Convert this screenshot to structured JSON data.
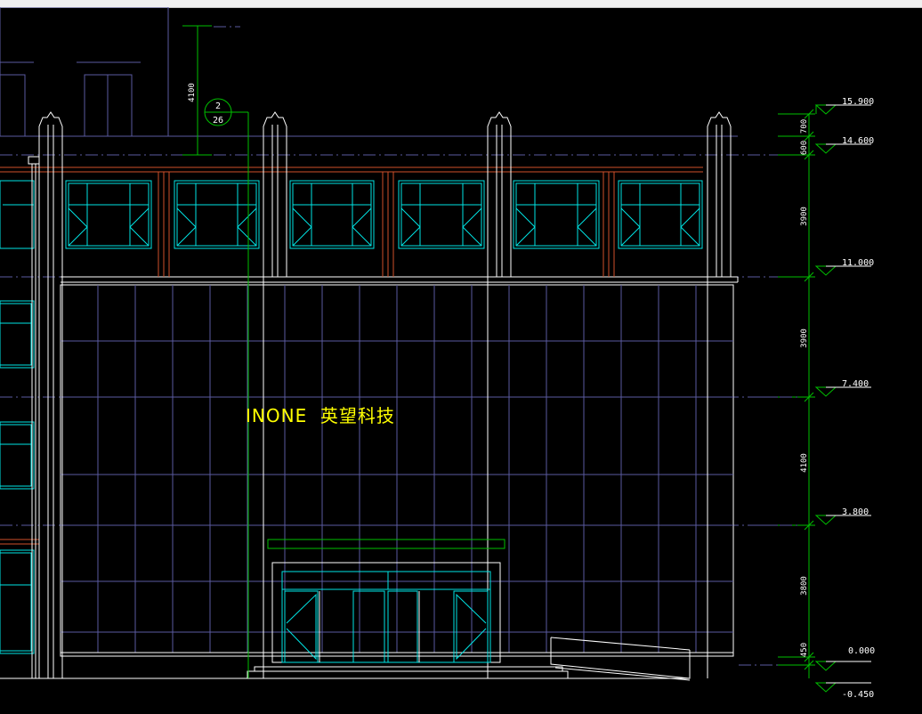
{
  "sign_text": "INONE  英望科技",
  "detail_tag": {
    "number": "2",
    "sheet": "26"
  },
  "top_dimension": "4100",
  "elevations": [
    "15.900",
    "14.600",
    "11.000",
    "7.400",
    "3.800",
    "0.000",
    "-0.450"
  ],
  "dimensions": [
    "600",
    "700",
    "3900",
    "3900",
    "4100",
    "3800",
    "450"
  ],
  "colors": {
    "background": "#000000",
    "outline": "#ffffff",
    "grid": "#5a5aa0",
    "window": "#00e5e5",
    "cornice": "#d0502a",
    "green": "#00c000",
    "sign": "#ffff00"
  }
}
